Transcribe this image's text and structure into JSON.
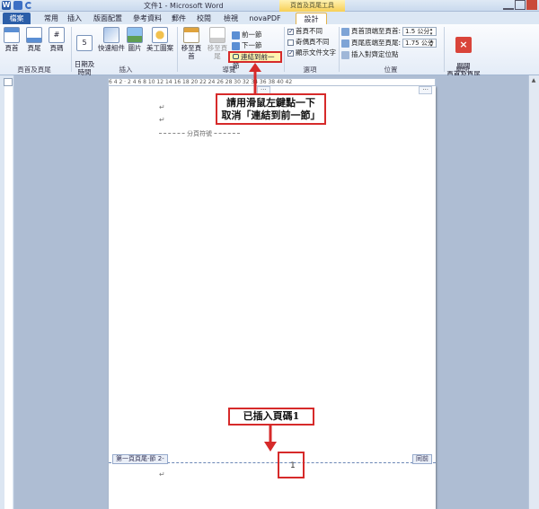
{
  "window": {
    "title": "文件1 - Microsoft Word",
    "context_group": "頁首及頁尾工具"
  },
  "tabs": [
    {
      "label": "檔案"
    },
    {
      "label": "常用"
    },
    {
      "label": "插入"
    },
    {
      "label": "版面配置"
    },
    {
      "label": "參考資料"
    },
    {
      "label": "郵件"
    },
    {
      "label": "校閱"
    },
    {
      "label": "檢視"
    },
    {
      "label": "novaPDF"
    },
    {
      "label": "設計"
    }
  ],
  "ribbon": {
    "header_footer": {
      "label": "頁首及頁尾",
      "header": "頁首",
      "footer": "頁尾",
      "page_number": "頁碼"
    },
    "insert": {
      "label": "插入",
      "datetime": "日期及\n時間",
      "quickparts": "快速組件",
      "picture": "圖片",
      "clipart": "美工圖案"
    },
    "navigation": {
      "label": "導覽",
      "goto_header": "移至頁首",
      "goto_footer": "移至頁尾",
      "previous": "前一節",
      "next": "下一節",
      "link_previous": "連結到前一節"
    },
    "options": {
      "label": "選項",
      "different_first": "首頁不同",
      "different_odd_even": "奇偶頁不同",
      "show_doc_text": "顯示文件文字"
    },
    "position": {
      "label": "位置",
      "header_from_top": "頁首頂端至頁首:",
      "header_value": "1.5 公分",
      "footer_from_bottom": "頁尾底端至頁尾:",
      "footer_value": "1.75 公分",
      "insert_align_tab": "插入對齊定位點"
    },
    "close": {
      "label": "關閉",
      "close_btn": "關閉\n頁首及頁尾"
    }
  },
  "ruler": {
    "ticks": "6  4  2  ·  2  4  6  8  10  12  14  16  18  20  22  24  26  28  30  32  34  36  38  40  42"
  },
  "document": {
    "page_break": "分頁符號",
    "footer_tag": "第一頁頁尾-節 2-",
    "footer_tag_right": "同前",
    "page_number": "1",
    "para_mark": "↵"
  },
  "callouts": {
    "unlink_line1": "請用滑鼠左鍵點一下",
    "unlink_line2": "取消「連結到前一節」",
    "inserted": "已插入頁碼1"
  },
  "colors": {
    "accent": "#d62a2a",
    "file_tab": "#2b5ea8"
  }
}
